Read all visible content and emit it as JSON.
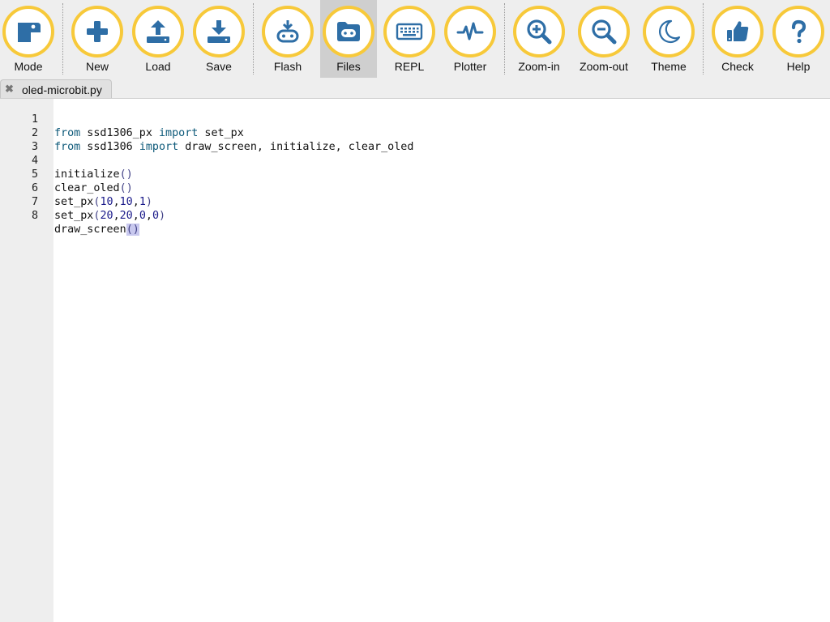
{
  "toolbar": {
    "buttons": [
      {
        "label": "Mode",
        "icon": "mode-icon"
      },
      {
        "label": "New",
        "icon": "plus-icon"
      },
      {
        "label": "Load",
        "icon": "upload-icon"
      },
      {
        "label": "Save",
        "icon": "download-icon"
      },
      {
        "label": "Flash",
        "icon": "flash-icon"
      },
      {
        "label": "Files",
        "icon": "folder-icon",
        "active": true
      },
      {
        "label": "REPL",
        "icon": "keyboard-icon"
      },
      {
        "label": "Plotter",
        "icon": "pulse-icon"
      },
      {
        "label": "Zoom-in",
        "icon": "zoom-in-icon"
      },
      {
        "label": "Zoom-out",
        "icon": "zoom-out-icon"
      },
      {
        "label": "Theme",
        "icon": "moon-icon"
      },
      {
        "label": "Check",
        "icon": "thumbs-up-icon"
      },
      {
        "label": "Help",
        "icon": "question-icon"
      }
    ],
    "accent_color": "#f7c93a",
    "icon_color": "#2e6ea6"
  },
  "tabs": [
    {
      "label": "oled-microbit.py",
      "close_symbol": "✖"
    }
  ],
  "editor": {
    "lines": [
      {
        "number": "1",
        "text": "from ssd1306_px import set_px"
      },
      {
        "number": "2",
        "text": "from ssd1306 import draw_screen, initialize, clear_oled"
      },
      {
        "number": "3",
        "text": ""
      },
      {
        "number": "4",
        "text": "initialize()"
      },
      {
        "number": "5",
        "text": "clear_oled()"
      },
      {
        "number": "6",
        "text": "set_px(10,10,1)"
      },
      {
        "number": "7",
        "text": "set_px(20,20,0,0)"
      },
      {
        "number": "8",
        "text": "draw_screen()"
      }
    ]
  }
}
